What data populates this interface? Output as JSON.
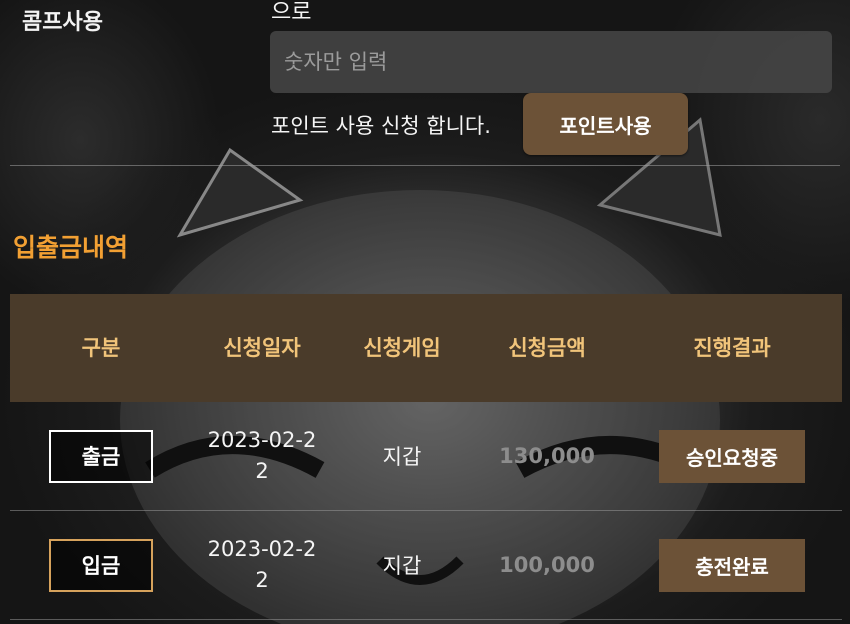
{
  "points": {
    "section_label": "콤프사용",
    "prefix_text": "으로",
    "input_placeholder": "숫자만 입력",
    "apply_text": "포인트 사용 신청 합니다.",
    "use_button_label": "포인트사용"
  },
  "history": {
    "title": "입출금내역",
    "columns": [
      "구분",
      "신청일자",
      "신청게임",
      "신청금액",
      "진행결과"
    ],
    "rows": [
      {
        "type": "출금",
        "date": "2023-02-22",
        "game": "지갑",
        "amount": "130,000",
        "status": "승인요청중"
      },
      {
        "type": "입금",
        "date": "2023-02-22",
        "game": "지갑",
        "amount": "100,000",
        "status": "충전완료"
      }
    ]
  },
  "colors": {
    "accent_orange": "#f2a033",
    "header_bg": "#4a3b2a",
    "header_text": "#f1c47a",
    "button_brown": "#6c5237",
    "deposit_border": "#d6a25c"
  }
}
